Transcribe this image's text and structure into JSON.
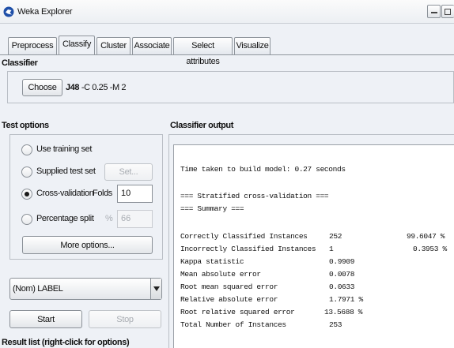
{
  "window": {
    "title": "Weka Explorer"
  },
  "tabs": [
    {
      "label": "Preprocess"
    },
    {
      "label": "Classify"
    },
    {
      "label": "Cluster"
    },
    {
      "label": "Associate"
    },
    {
      "label": "Select attributes"
    },
    {
      "label": "Visualize"
    }
  ],
  "classifier": {
    "section_label": "Classifier",
    "choose_label": "Choose",
    "name": "J48",
    "options": "-C 0.25 -M 2"
  },
  "test_options": {
    "section_label": "Test options",
    "use_training_set": "Use training set",
    "supplied_test_set": "Supplied test set",
    "set_button": "Set...",
    "cross_validation": "Cross-validation",
    "folds_label": "Folds",
    "folds_value": "10",
    "percentage_split": "Percentage split",
    "percent_symbol": "%",
    "percent_value": "66",
    "more_options": "More options...",
    "selected": "cross_validation"
  },
  "class_select": {
    "value": "(Nom) LABEL"
  },
  "run": {
    "start_label": "Start",
    "stop_label": "Stop"
  },
  "result_list": {
    "label": "Result list (right-click for options)"
  },
  "output": {
    "section_label": "Classifier output",
    "time_line": "Time taken to build model: 0.27 seconds",
    "stratified_header": "=== Stratified cross-validation ===",
    "summary_header": "=== Summary ===",
    "rows": [
      {
        "name": "Correctly Classified Instances",
        "value": "252",
        "percent": "99.6047 %"
      },
      {
        "name": "Incorrectly Classified Instances",
        "value": "1",
        "percent": "0.3953 %"
      },
      {
        "name": "Kappa statistic",
        "value": "0.9909",
        "percent": ""
      },
      {
        "name": "Mean absolute error",
        "value": "0.0078",
        "percent": ""
      },
      {
        "name": "Root mean squared error",
        "value": "0.0633",
        "percent": ""
      },
      {
        "name": "Relative absolute error",
        "value": "1.7971 %",
        "percent": ""
      },
      {
        "name": "Root relative squared error",
        "value": "13.5688 %",
        "percent": ""
      },
      {
        "name": "Total Number of Instances",
        "value": "253",
        "percent": ""
      }
    ]
  },
  "colors": {
    "panel_bg": "#eef1f6",
    "border": "#8f959c",
    "disabled_text": "#a9adb3"
  },
  "icons": {
    "app": "weka-bird-icon",
    "dropdown": "triangle-down-icon"
  }
}
